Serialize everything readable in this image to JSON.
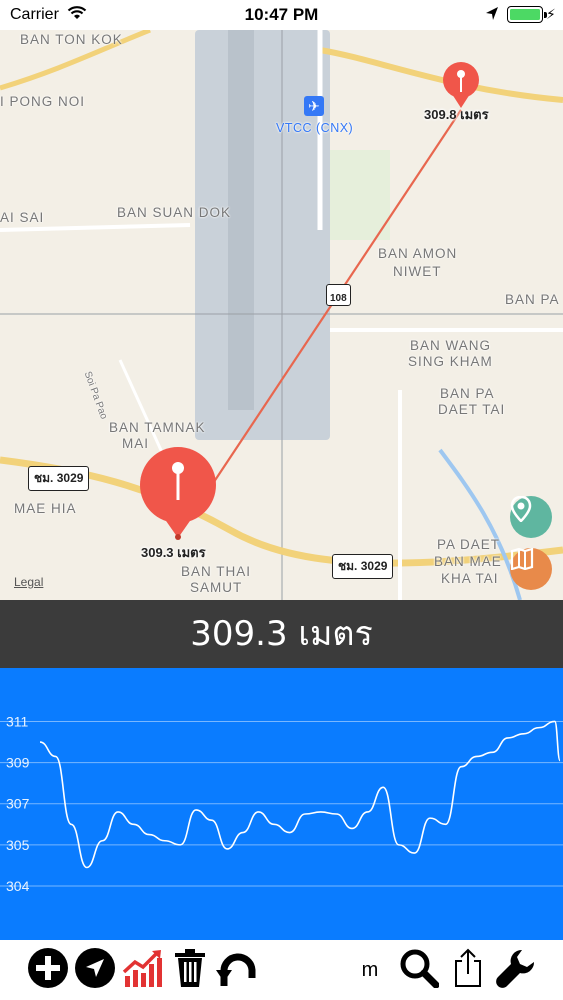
{
  "status_bar": {
    "carrier": "Carrier",
    "time": "10:47 PM"
  },
  "map": {
    "labels": {
      "ban_ton_kok": "BAN TON KOK",
      "pong_noi": "I PONG NOI",
      "ai_sai": "AI SAI",
      "ban_suan_dok": "BAN SUAN DOK",
      "ban_amon": "BAN AMON",
      "niwet": "NIWET",
      "ban_pa": "BAN PA",
      "ban_wang": "BAN WANG",
      "sing_kham": "SING KHAM",
      "ban_pa2": "BAN PA",
      "daet_tai": "DAET TAI",
      "ban_tamnak": "BAN TAMNAK",
      "mai": "MAI",
      "mae_hia": "MAE HIA",
      "ban_thai": "BAN THAI",
      "samut": "SAMUT",
      "pa_daet": "PA DAET",
      "ban_mae": "BAN MAE",
      "kha_tai": "KHA TAI",
      "soi_pa_pao": "Soi Pa Pao"
    },
    "airport_label": "VTCC (CNX)",
    "road_badges": {
      "road_3029_left": "ชม. 3029",
      "road_3029_right": "ชม. 3029",
      "road_108": "108"
    },
    "pin_start_label": "309.3 เมตร",
    "pin_end_label": "309.8 เมตร",
    "legal": "Legal",
    "colors": {
      "pin": "#f0564a",
      "route": "#e8674f",
      "info_button": "#5fb6a0",
      "guide_button": "#e88a4a"
    }
  },
  "elevation_readout": "309.3 เมตร",
  "chart_data": {
    "type": "line",
    "ylim": [
      303,
      311.8
    ],
    "yticks": [
      "311",
      "309",
      "307",
      "305",
      "304"
    ],
    "ytick_values": [
      311,
      309,
      307,
      305,
      303
    ],
    "line_color": "#ffffff",
    "background": "#0a7cff",
    "x": [
      0,
      3,
      6,
      9,
      12,
      15,
      18,
      21,
      24,
      27,
      30,
      33,
      36,
      39,
      42,
      45,
      48,
      51,
      54,
      57,
      60,
      63,
      66,
      69,
      72,
      75,
      78,
      81,
      84,
      87,
      90,
      93,
      96,
      99,
      100
    ],
    "values": [
      310.0,
      309.3,
      306.0,
      303.9,
      305.2,
      306.6,
      306.0,
      305.5,
      305.2,
      305.0,
      306.7,
      306.2,
      304.8,
      305.6,
      306.6,
      306.0,
      305.6,
      306.5,
      306.6,
      306.5,
      305.8,
      306.6,
      307.8,
      305.0,
      304.6,
      306.3,
      306.0,
      308.8,
      309.3,
      309.5,
      310.2,
      310.4,
      310.7,
      311.0,
      309.1
    ]
  },
  "toolbar": {
    "unit_label": "m"
  }
}
